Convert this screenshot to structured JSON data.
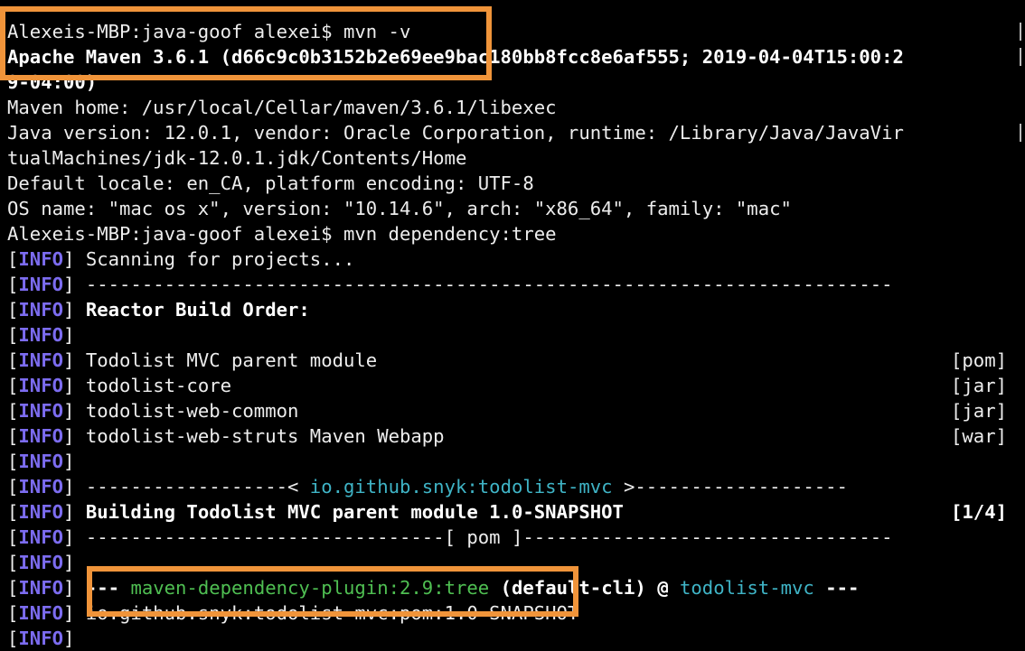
{
  "window": {
    "lines": {
      "prompt1": "Alexeis-MBP:java-goof alexei$ mvn -v",
      "maven_version": "Apache Maven 3.6.1 (d66c9c0b3152b2e69ee9bac180bb8fcc8e6af555; 2019-04-04T15:00:2",
      "maven_version_cont": "9-04:00)",
      "maven_home": "Maven home: /usr/local/Cellar/maven/3.6.1/libexec",
      "java_version": "Java version: 12.0.1, vendor: Oracle Corporation, runtime: /Library/Java/JavaVir",
      "java_version_cont": "tualMachines/jdk-12.0.1.jdk/Contents/Home",
      "locale": "Default locale: en_CA, platform encoding: UTF-8",
      "os": "OS name: \"mac os x\", version: \"10.14.6\", arch: \"x86_64\", family: \"mac\"",
      "prompt2": "Alexeis-MBP:java-goof alexei$ mvn dependency:tree"
    },
    "log": {
      "level": "INFO",
      "scanning": " Scanning for projects...",
      "separator": " ------------------------------------------------------------------------",
      "reactor": "Reactor Build Order:",
      "modules": [
        {
          "name": "Todolist MVC parent module",
          "type": "[pom]"
        },
        {
          "name": "todolist-core",
          "type": "[jar]"
        },
        {
          "name": "todolist-web-common",
          "type": "[jar]"
        },
        {
          "name": "todolist-web-struts Maven Webapp",
          "type": "[war]"
        }
      ],
      "gav_left": " ------------------< ",
      "gav": "io.github.snyk:todolist-mvc",
      "gav_right": " >-------------------",
      "building": "Building Todolist MVC parent module 1.0-SNAPSHOT",
      "progress": "[1/4]",
      "packaging_line": " --------------------------------[ pom ]---------------------------------",
      "plugin_dashes": "---",
      "plugin": "maven-dependency-plugin:2.9:tree",
      "execution": "(default-cli)",
      "at": " @ ",
      "artifact": "todolist-mvc",
      "plugin_end": " ---",
      "tree_root": " io.github.snyk:todolist-mvc:pom:1.0-SNAPSHOT"
    }
  },
  "colors": {
    "background": "#000000",
    "text": "#ededed",
    "info_level": "#7c6cf0",
    "plugin_green": "#4fbf52",
    "artifact_cyan": "#3fb4c6",
    "highlight_box": "#f0943a"
  }
}
